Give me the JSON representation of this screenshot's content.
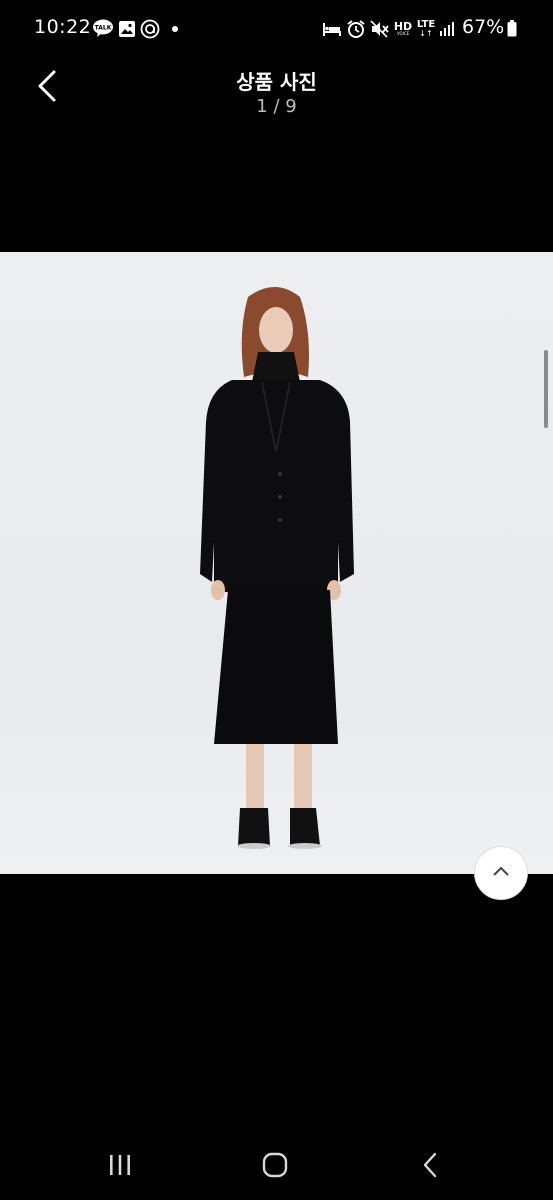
{
  "status_bar": {
    "time": "10:22",
    "battery": "67%",
    "hd_label": "HD",
    "hd_sub": "VOICE",
    "lte_label": "LTE",
    "icons": [
      "talk-icon",
      "gallery-icon",
      "at-icon",
      "dot-icon",
      "sleep-icon",
      "alarm-icon",
      "mute-icon",
      "hd-voice-icon",
      "lte-icon",
      "signal-icon",
      "battery-icon"
    ],
    "talk_label": "TALK"
  },
  "header": {
    "title": "상품 사진",
    "counter": "1 / 9"
  },
  "photo": {
    "subject": "product-photo"
  },
  "navbar": {
    "buttons": [
      "recent-apps",
      "home",
      "back"
    ]
  },
  "colors": {
    "background": "#000000",
    "photo_bg": "#eceef0",
    "counter_text": "#bdbdbd"
  }
}
